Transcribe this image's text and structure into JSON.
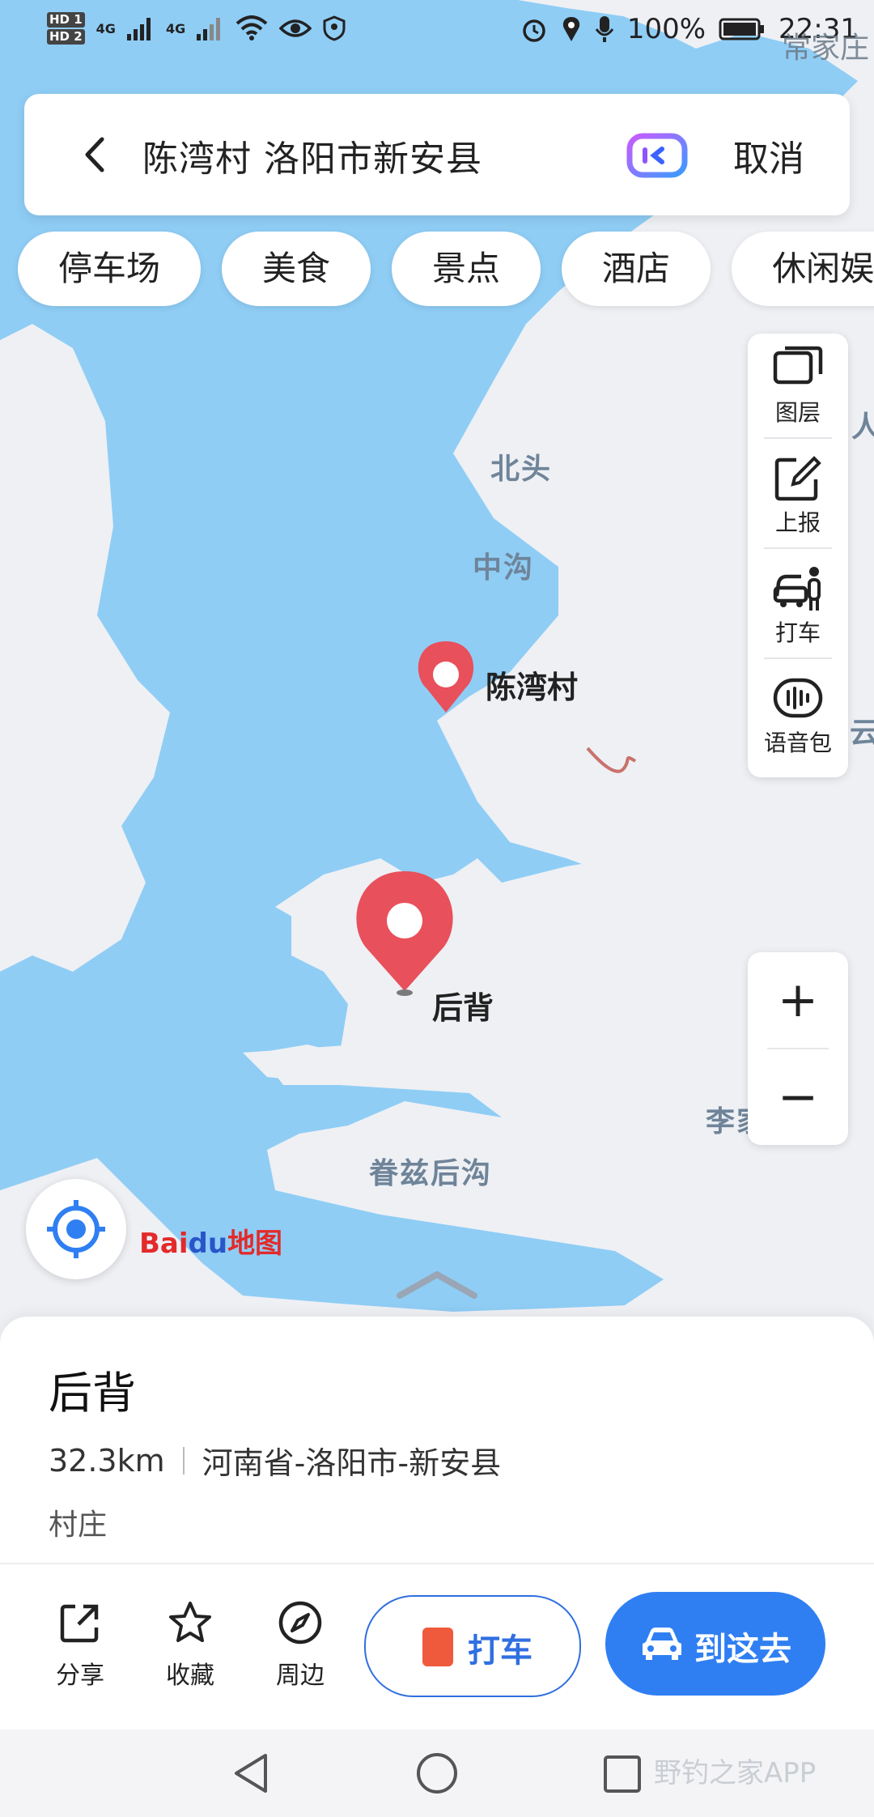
{
  "status_bar": {
    "sim1": "HD 1",
    "sim2": "HD 2",
    "network1": "4G",
    "network2": "4G",
    "battery": "100%",
    "time": "22:31",
    "corner_label": "常家庄"
  },
  "search": {
    "query": "陈湾村 洛阳市新安县",
    "cancel_label": "取消"
  },
  "categories": [
    "停车场",
    "美食",
    "景点",
    "酒店",
    "休闲娱"
  ],
  "tools": {
    "layers": "图层",
    "report": "上报",
    "taxi": "打车",
    "voice_pack": "语音包"
  },
  "map_labels": {
    "north_head": "北头",
    "middle_ditch": "中沟",
    "chenwan": "陈湾村",
    "houbei": "后背",
    "juanzi": "眷兹后沟",
    "li": "李家",
    "edge_right1": "人",
    "edge_right2": "云"
  },
  "zoom": {
    "in": "+",
    "out": "−"
  },
  "logo": {
    "bai": "Bai",
    "du": "du",
    "map": "地图"
  },
  "place": {
    "name": "后背",
    "distance": "32.3km",
    "address": "河南省-洛阳市-新安县",
    "category": "村庄"
  },
  "actions": {
    "share": "分享",
    "favorite": "收藏",
    "nearby": "周边",
    "taxi": "打车",
    "go": "到这去"
  },
  "watermark": "野钓之家APP",
  "colors": {
    "water": "#8fcdf5",
    "land": "#eef0f4",
    "marker": "#e8505b",
    "accent": "#2f7ff2"
  }
}
